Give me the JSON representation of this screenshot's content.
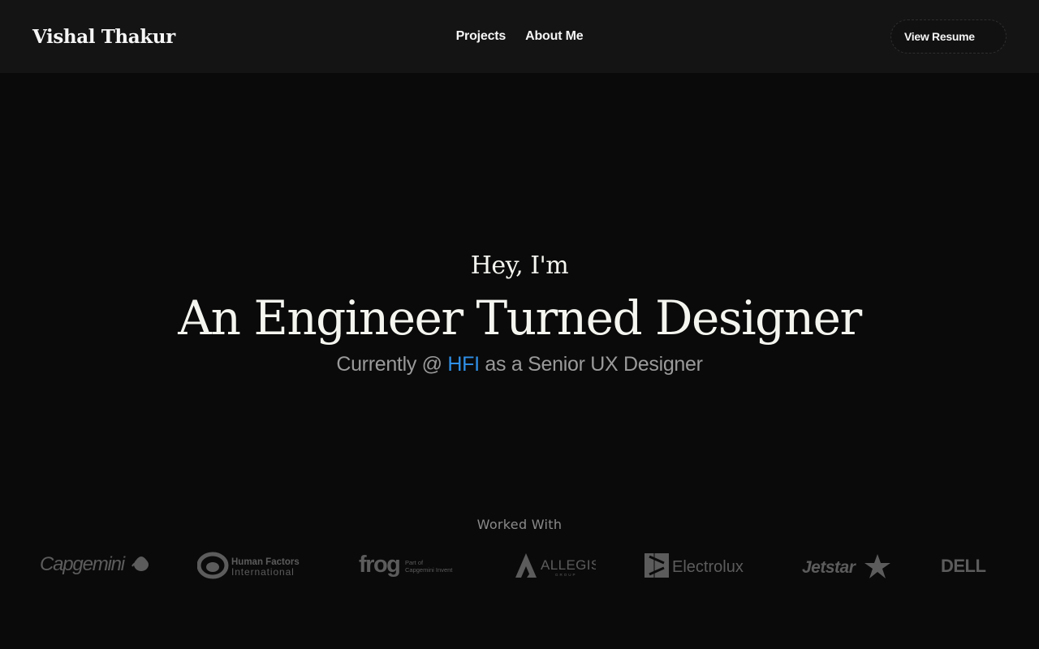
{
  "header": {
    "brand": "Vishal Thakur",
    "nav": [
      {
        "label": "Projects"
      },
      {
        "label": "About Me"
      }
    ],
    "resume_label": "View Resume"
  },
  "hero": {
    "greeting": "Hey, I'm",
    "title": "An Engineer Turned Designer",
    "subtitle_prefix": "Currently @ ",
    "subtitle_company": "HFI",
    "subtitle_suffix": " as a Senior UX Designer",
    "accent_color": "#2f8fe6"
  },
  "worked_with": {
    "title": "Worked With",
    "logos": [
      {
        "name": "Capgemini",
        "text": "Capgemini"
      },
      {
        "name": "Human Factors International",
        "line1": "Human Factors",
        "line2": "International"
      },
      {
        "name": "frog",
        "text": "frog",
        "small1": "Part of",
        "small2": "Capgemini Invent"
      },
      {
        "name": "Allegis Group",
        "text": "ALLEGIS",
        "small": "GROUP"
      },
      {
        "name": "Electrolux",
        "text": "Electrolux"
      },
      {
        "name": "Jetstar",
        "text": "Jetstar"
      },
      {
        "name": "Dell",
        "text": "DELL"
      }
    ]
  }
}
